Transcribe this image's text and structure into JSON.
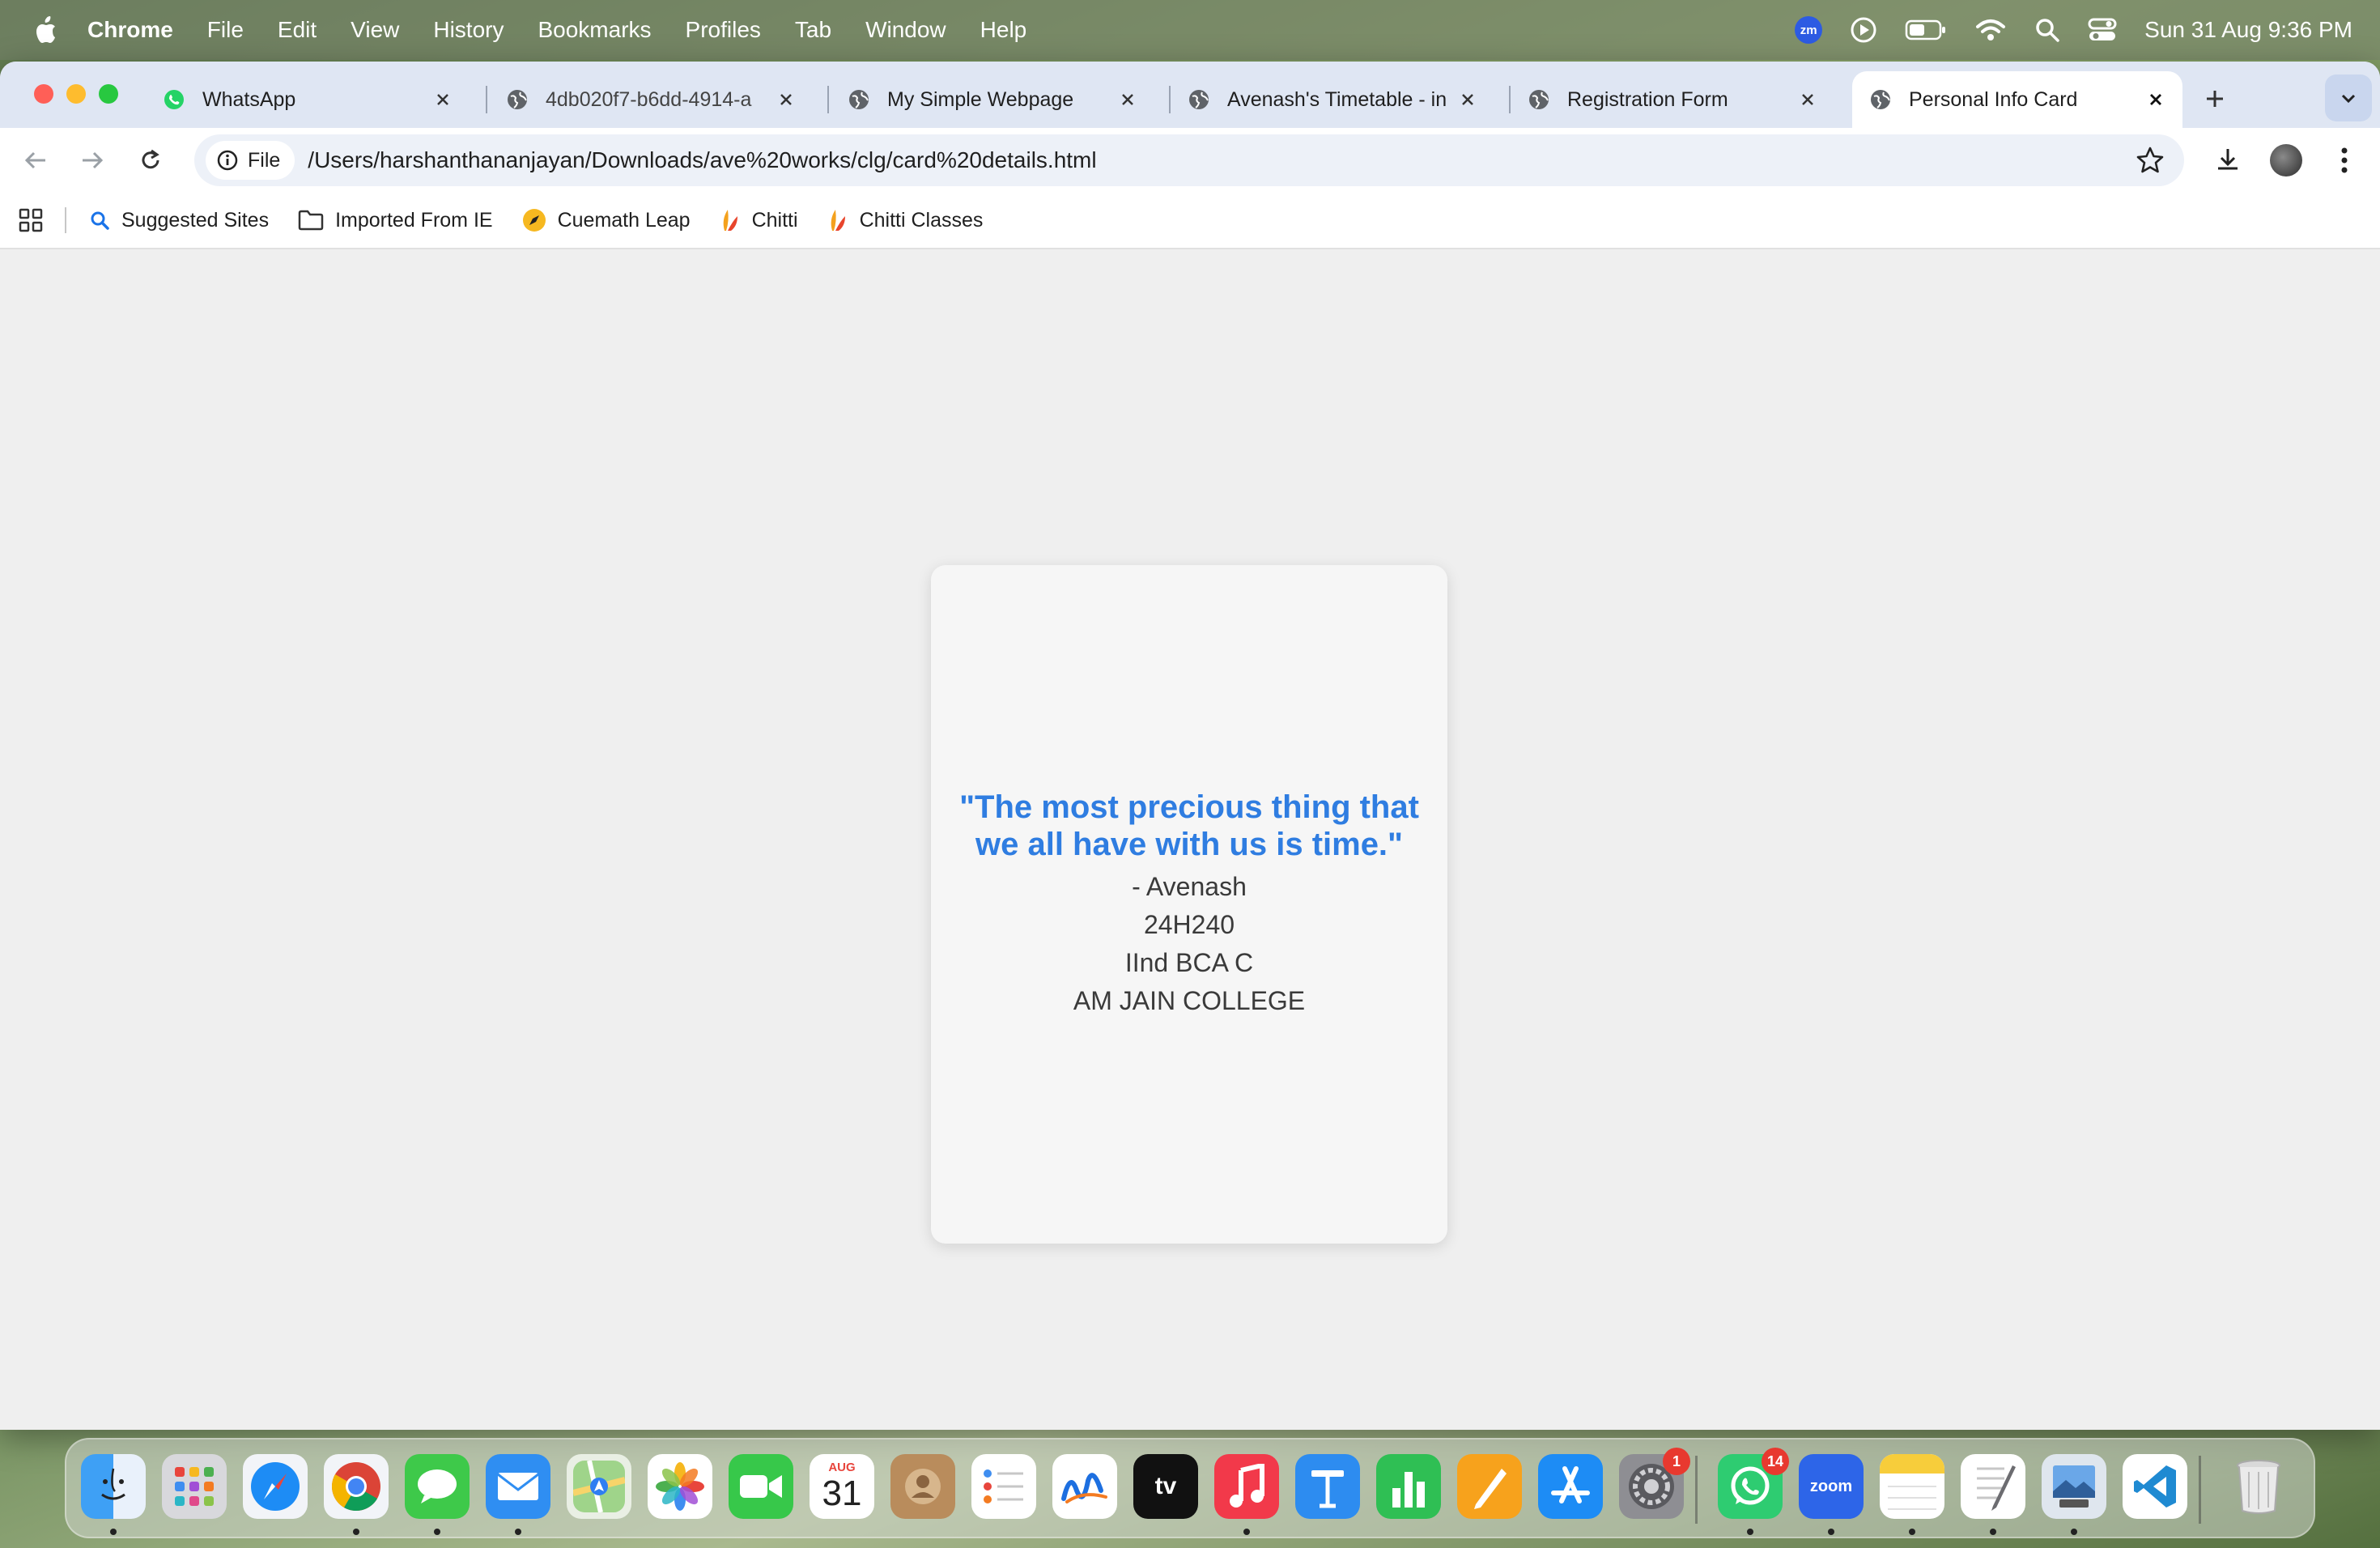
{
  "menubar": {
    "app_name": "Chrome",
    "items": [
      "File",
      "Edit",
      "View",
      "History",
      "Bookmarks",
      "Profiles",
      "Tab",
      "Window",
      "Help"
    ],
    "zoom_badge": "zm",
    "datetime": "Sun 31 Aug  9:36 PM"
  },
  "tabs": [
    {
      "title": "WhatsApp",
      "icon": "whatsapp-icon"
    },
    {
      "title": "4db020f7-b6dd-4914-a",
      "icon": "globe-icon"
    },
    {
      "title": "My Simple Webpage",
      "icon": "globe-icon"
    },
    {
      "title": "Avenash's Timetable - in",
      "icon": "globe-icon"
    },
    {
      "title": "Registration Form",
      "icon": "globe-icon"
    },
    {
      "title": "Personal Info Card",
      "icon": "globe-icon",
      "active": true
    }
  ],
  "toolbar": {
    "scheme_label": "File",
    "url": "/Users/harshanthananjayan/Downloads/ave%20works/clg/card%20details.html"
  },
  "bookmarks": [
    {
      "label": "Suggested Sites",
      "icon": "search-icon"
    },
    {
      "label": "Imported From IE",
      "icon": "folder-icon"
    },
    {
      "label": "Cuemath Leap",
      "icon": "rocket-icon"
    },
    {
      "label": "Chitti",
      "icon": "chitti-icon"
    },
    {
      "label": "Chitti Classes",
      "icon": "chitti-icon"
    }
  ],
  "card": {
    "quote": "\"The most precious thing that we all have with us is time.\"",
    "author": "- Avenash",
    "roll_no": "24H240",
    "class": "IInd BCA C",
    "college": "AM JAIN COLLEGE"
  },
  "colors": {
    "quote": "#2f7de1",
    "card_bg": "#f6f6f6",
    "page_bg": "#efefef",
    "tabstrip_bg": "#dfe6f3"
  },
  "dock": {
    "calendar_month": "AUG",
    "calendar_day": "31",
    "zoom_label": "zoom",
    "settings_badge": "1",
    "whatsapp_badge": "14",
    "apps": [
      "finder-icon",
      "launchpad-icon",
      "safari-icon",
      "chrome-icon",
      "messages-icon",
      "mail-icon",
      "maps-icon",
      "photos-icon",
      "facetime-icon",
      "calendar-icon",
      "contacts-icon",
      "reminders-icon",
      "freeform-icon",
      "appletv-icon",
      "music-icon",
      "keynote-icon",
      "numbers-icon",
      "pages-icon",
      "appstore-icon",
      "system-settings-icon",
      "whatsapp-icon",
      "zoom-icon",
      "notes-icon",
      "textedit-icon",
      "preview-icon",
      "vscode-icon",
      "trash-icon"
    ]
  }
}
